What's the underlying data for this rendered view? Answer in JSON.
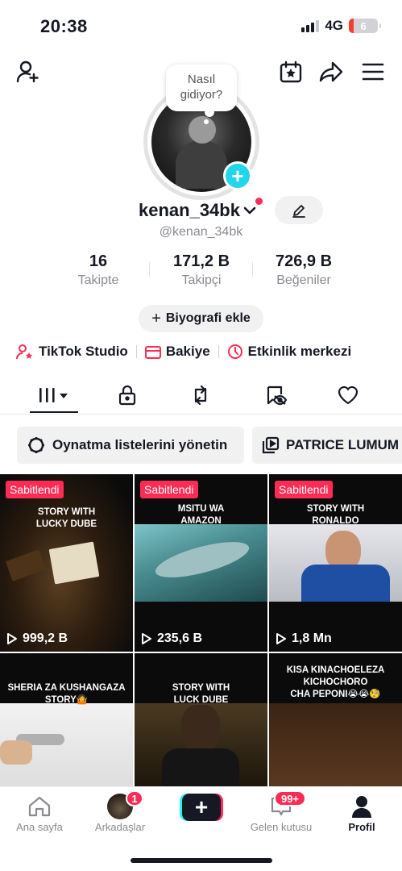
{
  "status_bar": {
    "time": "20:38",
    "network": "4G",
    "battery": "6",
    "battery_level": 0.06
  },
  "profile": {
    "bubble_text_1": "Nasıl",
    "bubble_text_2": "gidiyor?",
    "username": "kenan_34bk",
    "handle": "@kenan_34bk",
    "stats": [
      {
        "value": "16",
        "label": "Takipte"
      },
      {
        "value": "171,2 B",
        "label": "Takipçi"
      },
      {
        "value": "726,9 B",
        "label": "Beğeniler"
      }
    ],
    "bio_button": "Biyografi ekle"
  },
  "quick_links": [
    {
      "label": "TikTok Studio",
      "icon": "person-star-icon"
    },
    {
      "label": "Bakiye",
      "icon": "wallet-icon"
    },
    {
      "label": "Etkinlik merkezi",
      "icon": "clock-icon"
    }
  ],
  "tabs": [
    "videos-grid-icon",
    "lock-icon",
    "repost-icon",
    "hidden-eye-icon",
    "heart-icon"
  ],
  "chips": [
    {
      "label": "Oynatma listelerini yönetin",
      "icon": "gear-icon"
    },
    {
      "label": "PATRICE LUMUM",
      "icon": "playlist-icon"
    }
  ],
  "videos": [
    {
      "pinned": "Sabitlendi",
      "caption": "STORY WITH\nLUCKY DUBE",
      "views": "999,2 B"
    },
    {
      "pinned": "Sabitlendi",
      "caption": "MSITU WA\nAMAZON",
      "views": "235,6 B"
    },
    {
      "pinned": "Sabitlendi",
      "caption": "STORY WITH\nRONALDO",
      "views": "1,8 Mn"
    },
    {
      "pinned": "",
      "caption": "SHERIA ZA KUSHANGAZA\nSTORY🤷",
      "views": ""
    },
    {
      "pinned": "",
      "caption": "STORY WITH\nLUCK DUBE",
      "views": ""
    },
    {
      "pinned": "",
      "caption": "KISA KINACHOELEZA\nKICHOCHORO\nCHA PEPONI😭😭🧐",
      "views": ""
    }
  ],
  "bottom_nav": [
    {
      "label": "Ana sayfa",
      "icon": "home-icon"
    },
    {
      "label": "Arkadaşlar",
      "icon": "friends-avatar",
      "badge": "1"
    },
    {
      "label": "",
      "icon": "create-plus-icon"
    },
    {
      "label": "Gelen kutusu",
      "icon": "inbox-icon",
      "badge": "99+"
    },
    {
      "label": "Profil",
      "icon": "profile-icon"
    }
  ],
  "colors": {
    "accent": "#fe2c55",
    "cyan": "#20d5ec",
    "text": "#161823",
    "muted": "#8a8b91"
  }
}
